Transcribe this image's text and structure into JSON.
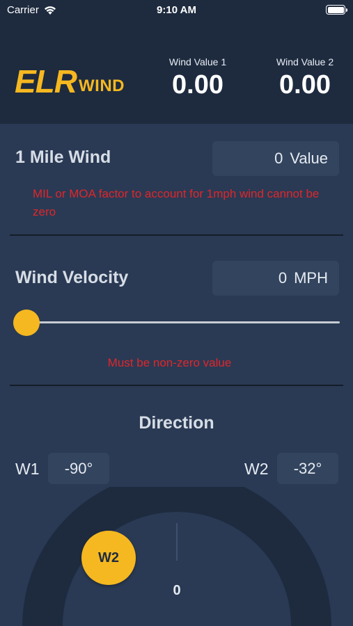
{
  "status_bar": {
    "carrier": "Carrier",
    "time": "9:10 AM",
    "icons": [
      "wifi-icon",
      "battery-icon"
    ]
  },
  "header": {
    "logo_main": "ELR",
    "logo_sub": "WIND",
    "wind_value_1": {
      "label": "Wind Value 1",
      "value": "0.00"
    },
    "wind_value_2": {
      "label": "Wind Value 2",
      "value": "0.00"
    }
  },
  "mile_wind": {
    "title": "1 Mile Wind",
    "value": "0",
    "unit": "Value",
    "error": "MIL or MOA factor to account for 1mph wind cannot be zero"
  },
  "wind_velocity": {
    "title": "Wind Velocity",
    "value": "0",
    "unit": "MPH",
    "slider_fraction": 0,
    "error": "Must be non-zero value"
  },
  "direction": {
    "title": "Direction",
    "w1_label": "W1",
    "w1_value": "-90°",
    "w2_label": "W2",
    "w2_value": "-32°",
    "dial_knob_label": "W2",
    "dial_center_value": "0"
  },
  "colors": {
    "header_bg": "#1e2b3f",
    "body_bg": "#2a3a54",
    "accent": "#f6b820",
    "error": "#e0262b",
    "input_bg": "#33445e"
  }
}
